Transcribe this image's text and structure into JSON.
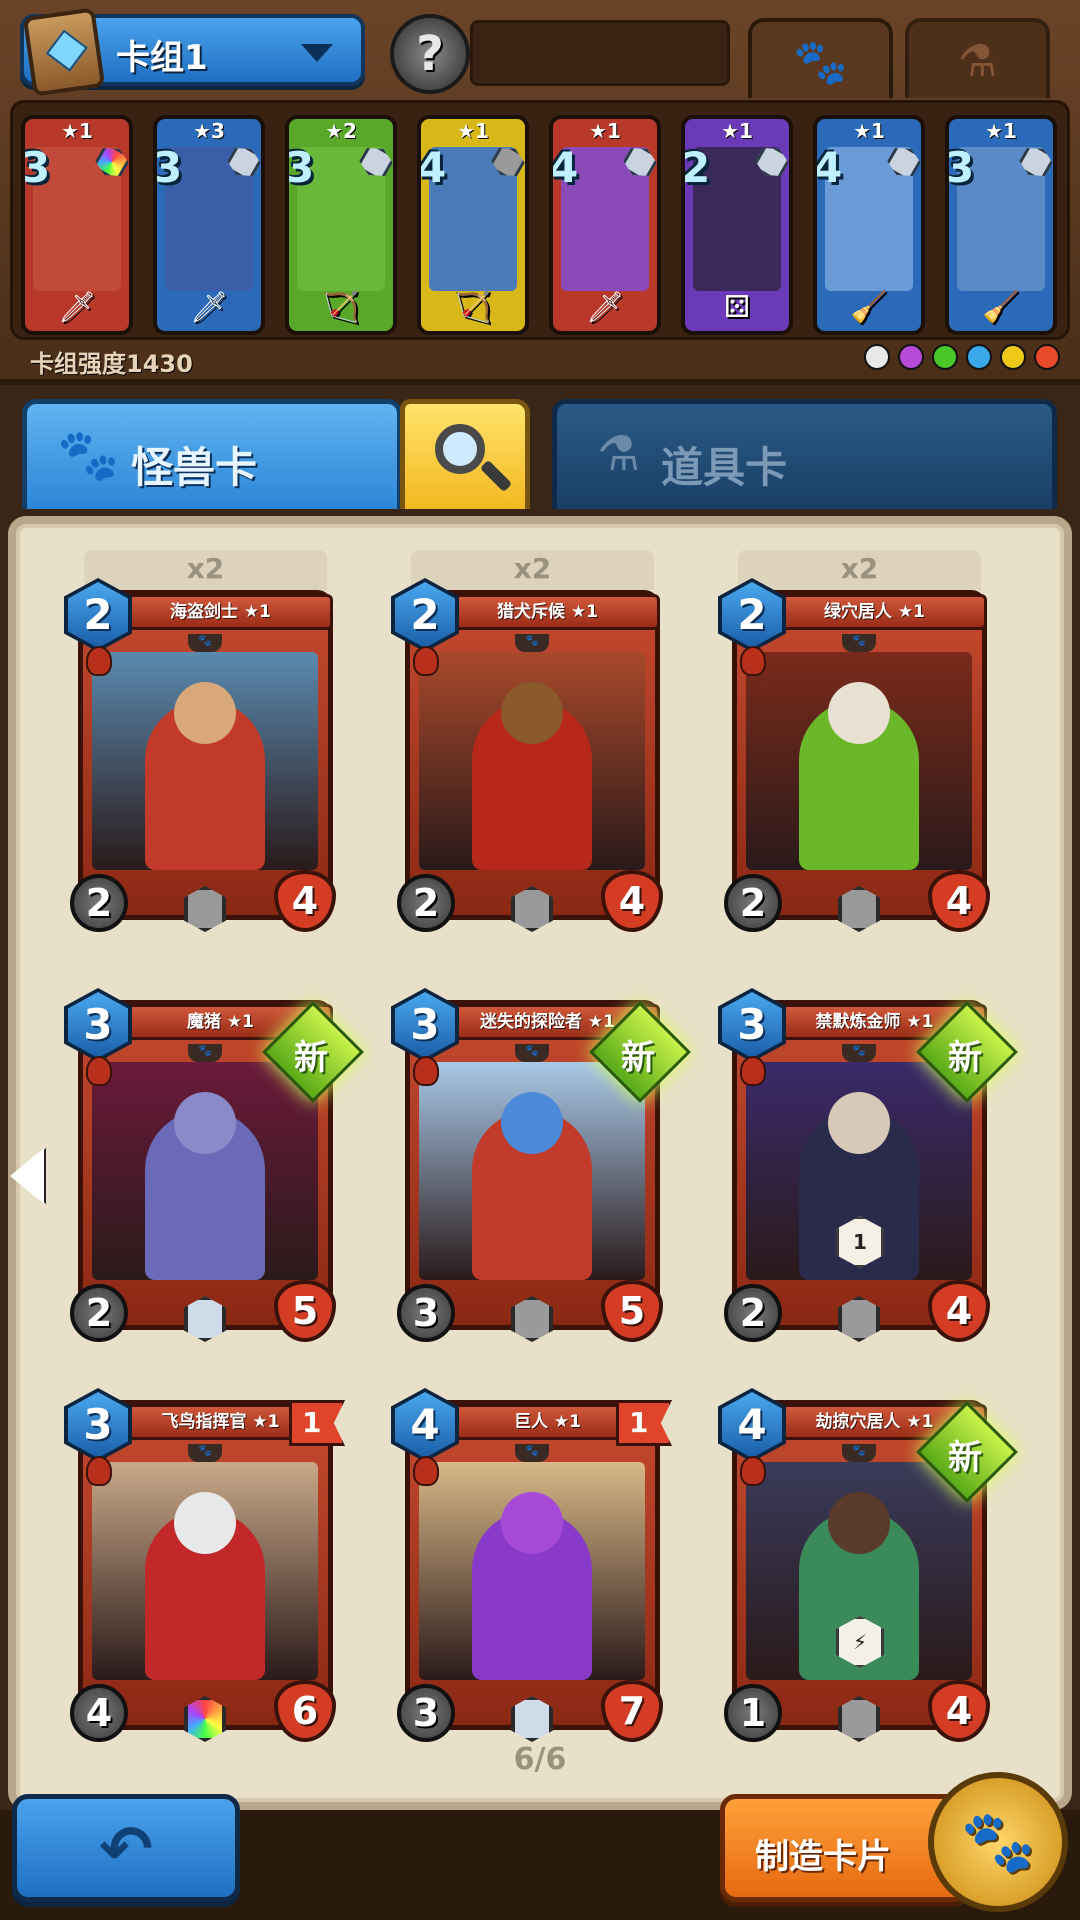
{
  "header": {
    "deck_name": "卡组1",
    "avatar_glyph": "?",
    "tabs": [
      {
        "icon": "paw-icon",
        "glyph": "🐾",
        "active": true
      },
      {
        "icon": "flask-icon",
        "glyph": "⚗",
        "active": false
      }
    ]
  },
  "deck": {
    "cards": [
      {
        "stars": "★1",
        "cost": "3",
        "frame_color": "#b8382a",
        "art_color": "#c24a3a",
        "gem": "rainbow",
        "weapon": "🗡"
      },
      {
        "stars": "★3",
        "cost": "3",
        "frame_color": "#2a6ab8",
        "art_color": "#3a5ea8",
        "gem": "silver",
        "weapon": "🗡"
      },
      {
        "stars": "★2",
        "cost": "3",
        "frame_color": "#5aa82a",
        "art_color": "#6ab83a",
        "gem": "silver",
        "weapon": "🏹"
      },
      {
        "stars": "★1",
        "cost": "4",
        "frame_color": "#d8b818",
        "art_color": "#4a7ab8",
        "gem": "grey",
        "weapon": "🏹"
      },
      {
        "stars": "★1",
        "cost": "4",
        "frame_color": "#b8382a",
        "art_color": "#8a4ab8",
        "gem": "silver",
        "weapon": "🗡"
      },
      {
        "stars": "★1",
        "cost": "2",
        "frame_color": "#6a3ab8",
        "art_color": "#3a2a5a",
        "gem": "silver",
        "weapon": "⚄"
      },
      {
        "stars": "★1",
        "cost": "4",
        "frame_color": "#2a6ab8",
        "art_color": "#6a9ad8",
        "gem": "silver",
        "weapon": "🧹"
      },
      {
        "stars": "★1",
        "cost": "3",
        "frame_color": "#2a6ab8",
        "art_color": "#5a8ac8",
        "gem": "silver",
        "weapon": "🧹"
      }
    ],
    "power_label": "卡组强度1430",
    "element_colors": [
      "#e8e8e8",
      "#b84ad8",
      "#4ac82a",
      "#3aa8e8",
      "#f0c818",
      "#e84a2a"
    ]
  },
  "category_tabs": {
    "monster_label": "怪兽卡",
    "item_label": "道具卡"
  },
  "collection": {
    "cards": [
      {
        "count": "x2",
        "name": "海盗剑士 ★1",
        "cost": "2",
        "attack": "2",
        "hp": "4",
        "rarity": "grey",
        "is_new": false,
        "flag": "",
        "ability": "",
        "art_bg": "#5a8ab0",
        "figure": "#c23a2a",
        "head": "#d8a878"
      },
      {
        "count": "x2",
        "name": "猎犬斥候 ★1",
        "cost": "2",
        "attack": "2",
        "hp": "4",
        "rarity": "grey",
        "is_new": false,
        "flag": "",
        "ability": "",
        "art_bg": "#a8482a",
        "figure": "#b8281a",
        "head": "#8a5a2a"
      },
      {
        "count": "x2",
        "name": "绿穴居人 ★1",
        "cost": "2",
        "attack": "2",
        "hp": "4",
        "rarity": "grey",
        "is_new": false,
        "flag": "",
        "ability": "",
        "art_bg": "#7a2a1a",
        "figure": "#6ab82a",
        "head": "#e8e0d0"
      },
      {
        "count": "",
        "name": "魔猪 ★1",
        "cost": "3",
        "attack": "2",
        "hp": "5",
        "rarity": "silver",
        "is_new": true,
        "flag": "",
        "ability": "",
        "art_bg": "#6a1a3a",
        "figure": "#6a6ab8",
        "head": "#8a8ac8"
      },
      {
        "count": "",
        "name": "迷失的探险者 ★1",
        "cost": "3",
        "attack": "3",
        "hp": "5",
        "rarity": "grey",
        "is_new": true,
        "flag": "",
        "ability": "",
        "art_bg": "#a8c8e8",
        "figure": "#c23a2a",
        "head": "#4a8ad8"
      },
      {
        "count": "",
        "name": "禁默炼金师 ★1",
        "cost": "3",
        "attack": "2",
        "hp": "4",
        "rarity": "grey",
        "is_new": true,
        "flag": "",
        "ability": "1",
        "art_bg": "#3a2a6a",
        "figure": "#2a2a4a",
        "head": "#d8c8b8"
      },
      {
        "count": "",
        "name": "飞鸟指挥官 ★1",
        "cost": "3",
        "attack": "4",
        "hp": "6",
        "rarity": "rainbow",
        "is_new": false,
        "flag": "1",
        "ability": "",
        "art_bg": "#c8a888",
        "figure": "#c2282a",
        "head": "#e8e8e8"
      },
      {
        "count": "",
        "name": "巨人 ★1",
        "cost": "4",
        "attack": "3",
        "hp": "7",
        "rarity": "silver",
        "is_new": false,
        "flag": "1",
        "ability": "",
        "art_bg": "#d8b888",
        "figure": "#8a3ac8",
        "head": "#a84ad8"
      },
      {
        "count": "",
        "name": "劫掠穴居人 ★1",
        "cost": "4",
        "attack": "1",
        "hp": "4",
        "rarity": "grey",
        "is_new": true,
        "flag": "",
        "ability": "⚡",
        "art_bg": "#3a3a5a",
        "figure": "#3a8a5a",
        "head": "#5a3a2a"
      }
    ],
    "page_indicator": "6/6"
  },
  "footer": {
    "back_glyph": "↶",
    "craft_label": "制造卡片",
    "craft_icon_glyph": "🐾"
  }
}
